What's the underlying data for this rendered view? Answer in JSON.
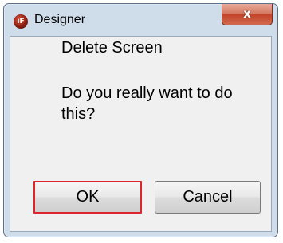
{
  "window": {
    "title": "Designer",
    "app_icon_text": "iF",
    "close_glyph": "x"
  },
  "dialog": {
    "heading": "Delete Screen",
    "message": "Do you really want to do this?"
  },
  "buttons": {
    "ok_label": "OK",
    "cancel_label": "Cancel"
  },
  "colors": {
    "frame": "#cfdcea",
    "content_bg": "#f0f0f0",
    "close_button": "#c2432a",
    "ok_highlight": "#e0242c"
  },
  "icons": {
    "app": "designer-app-icon",
    "close": "close-icon"
  }
}
